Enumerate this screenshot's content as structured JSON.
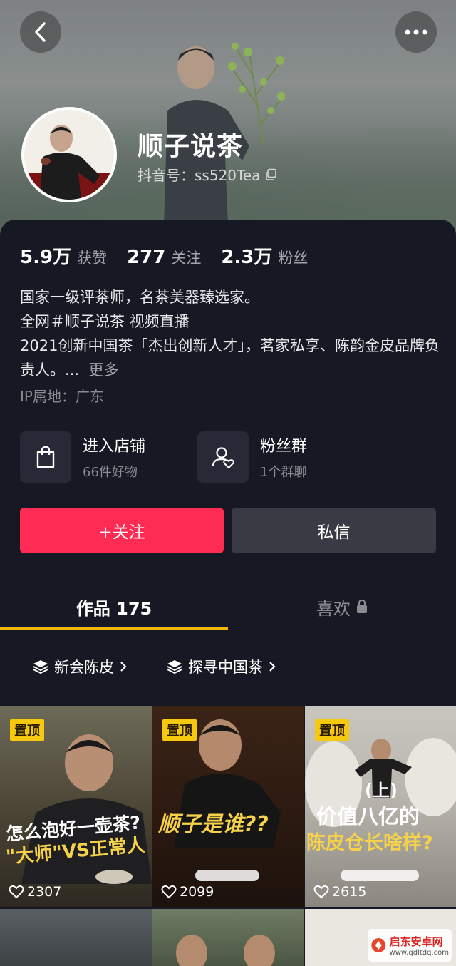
{
  "profile": {
    "name": "顺子说茶",
    "handle": "抖音号：ss520Tea"
  },
  "stats": [
    {
      "num": "5.9万",
      "label": "获赞"
    },
    {
      "num": "277",
      "label": "关注"
    },
    {
      "num": "2.3万",
      "label": "粉丝"
    }
  ],
  "bio": {
    "line1": "国家一级评茶师，名茶美器臻选家。",
    "line2": "全网＃顺子说茶 视频直播",
    "line3": "2021创新中国茶「杰出创新人才」，茗家私享、陈韵金皮品牌负责人。...",
    "more": "更多",
    "ip": "IP属地：广东"
  },
  "cards": {
    "shop": {
      "title": "进入店铺",
      "sub": "66件好物"
    },
    "fans": {
      "title": "粉丝群",
      "sub": "1个群聊"
    }
  },
  "actions": {
    "follow": "+关注",
    "message": "私信"
  },
  "tabs": {
    "works": "作品 175",
    "likes": "喜欢"
  },
  "collections": [
    "新会陈皮",
    "探寻中国茶"
  ],
  "videos": [
    {
      "pin": "置顶",
      "cap1": "怎么泡好一壶茶?",
      "cap2": "\"大师\"VS正常人",
      "likes": "2307"
    },
    {
      "pin": "置顶",
      "cap1": "顺子是谁??",
      "cap2": "",
      "likes": "2099"
    },
    {
      "pin": "置顶",
      "cap1": "(上)",
      "cap2": "价值八亿的",
      "cap3": "陈皮仓长啥样?",
      "likes": "2615"
    }
  ],
  "watermark": {
    "site": "启东安卓网",
    "url": "www.qdltdq.com"
  },
  "colors": {
    "accent_follow": "#fe2c55",
    "tab_indicator": "#f2b705",
    "pin_badge": "#f6c90e"
  }
}
